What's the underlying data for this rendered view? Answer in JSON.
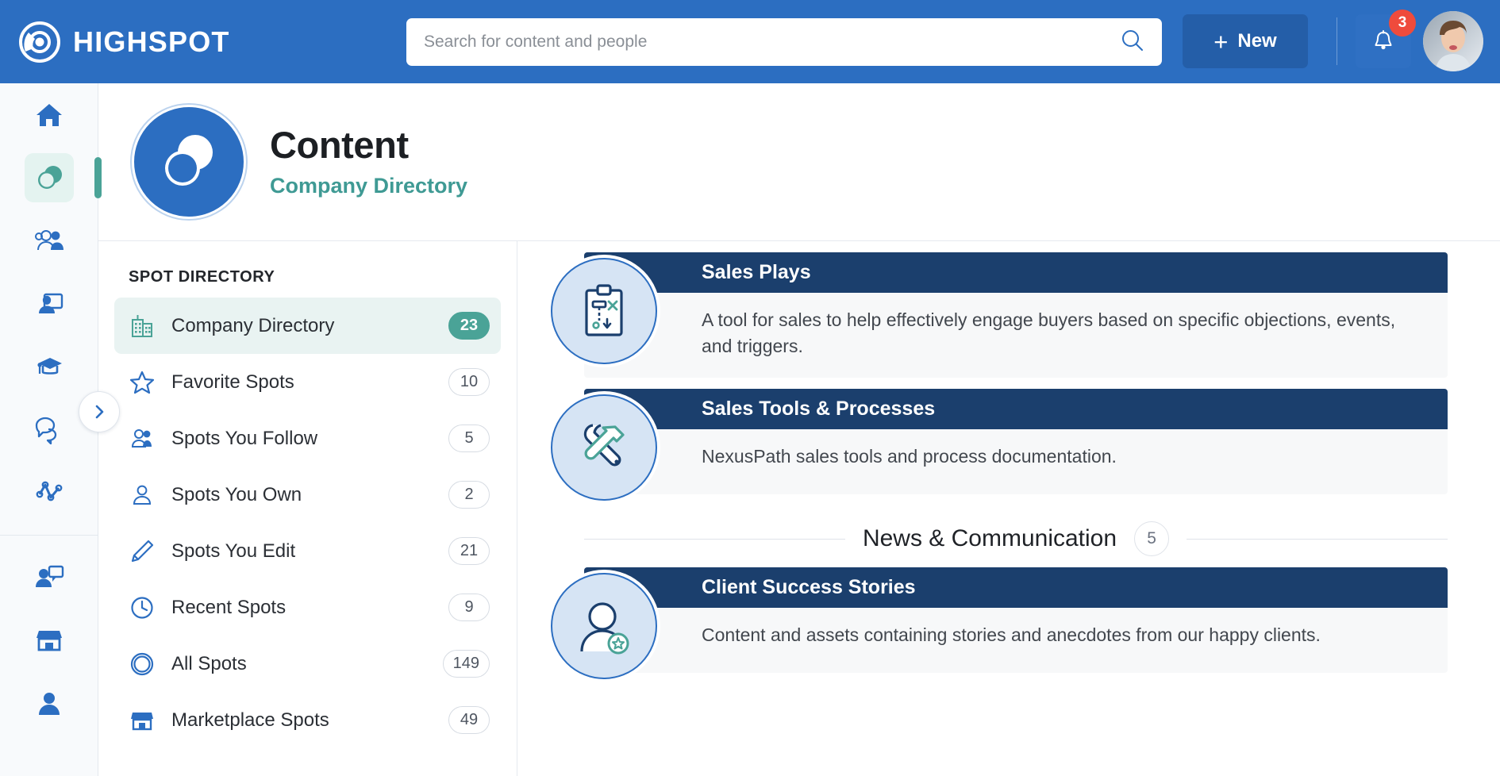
{
  "header": {
    "logo_text": "HIGHSPOT",
    "logo_icon": "highspot-logo-icon",
    "search": {
      "value": "",
      "placeholder": "Search for content and people",
      "icon": "search-icon"
    },
    "new_button": {
      "label": "New",
      "plus": "+"
    },
    "notifications": {
      "icon": "bell-icon",
      "count": "3"
    },
    "avatar": {
      "icon": "user-avatar"
    },
    "colors": {
      "bar": "#2c6ec1",
      "new_button": "#245ea8",
      "badge": "#ef4b3c"
    }
  },
  "rail": {
    "items": [
      {
        "name": "home",
        "icon": "home-icon",
        "active": false
      },
      {
        "name": "content",
        "icon": "content-spots-icon",
        "active": true
      },
      {
        "name": "people",
        "icon": "people-group-icon",
        "active": false
      },
      {
        "name": "pitch",
        "icon": "presentation-person-icon",
        "active": false
      },
      {
        "name": "training",
        "icon": "graduation-cap-icon",
        "active": false
      },
      {
        "name": "discussions",
        "icon": "chat-bubbles-icon",
        "active": false
      },
      {
        "name": "analytics",
        "icon": "analytics-line-icon",
        "active": false
      },
      {
        "name": "coaching",
        "icon": "person-speech-bubble-icon",
        "active": false
      },
      {
        "name": "marketplace",
        "icon": "storefront-icon",
        "active": false
      }
    ],
    "expand_icon": "chevron-right-icon",
    "active_color": "#4aa397"
  },
  "page": {
    "badge_icon": "spot-circles-icon",
    "title": "Content",
    "subtitle": "Company Directory",
    "subtitle_color": "#3f9a94"
  },
  "spot_directory": {
    "label": "SPOT DIRECTORY",
    "items": [
      {
        "label": "Company Directory",
        "count": "23",
        "icon": "building-icon",
        "active": true
      },
      {
        "label": "Favorite Spots",
        "count": "10",
        "icon": "star-outline-icon",
        "active": false
      },
      {
        "label": "Spots You Follow",
        "count": "5",
        "icon": "two-people-icon",
        "active": false
      },
      {
        "label": "Spots You Own",
        "count": "2",
        "icon": "person-icon",
        "active": false
      },
      {
        "label": "Spots You Edit",
        "count": "21",
        "icon": "pencil-icon",
        "active": false
      },
      {
        "label": "Recent Spots",
        "count": "9",
        "icon": "clock-icon",
        "active": false
      },
      {
        "label": "All Spots",
        "count": "149",
        "icon": "circle-ring-icon",
        "active": false
      },
      {
        "label": "Marketplace Spots",
        "count": "49",
        "icon": "storefront-icon",
        "active": false
      }
    ]
  },
  "main": {
    "cards_top": [
      {
        "title": "Sales Plays",
        "description": "A tool for sales to help effectively engage buyers based on specific objections, events, and triggers.",
        "icon": "clipboard-strategy-icon"
      },
      {
        "title": "Sales Tools & Processes",
        "description": "NexusPath sales tools and process documentation.",
        "icon": "wrench-hammer-icon"
      }
    ],
    "group": {
      "title": "News & Communication",
      "count": "5"
    },
    "cards_bottom": [
      {
        "title": "Client Success Stories",
        "description": "Content and assets containing stories and anecdotes from our happy clients.",
        "icon": "person-star-icon"
      }
    ]
  }
}
